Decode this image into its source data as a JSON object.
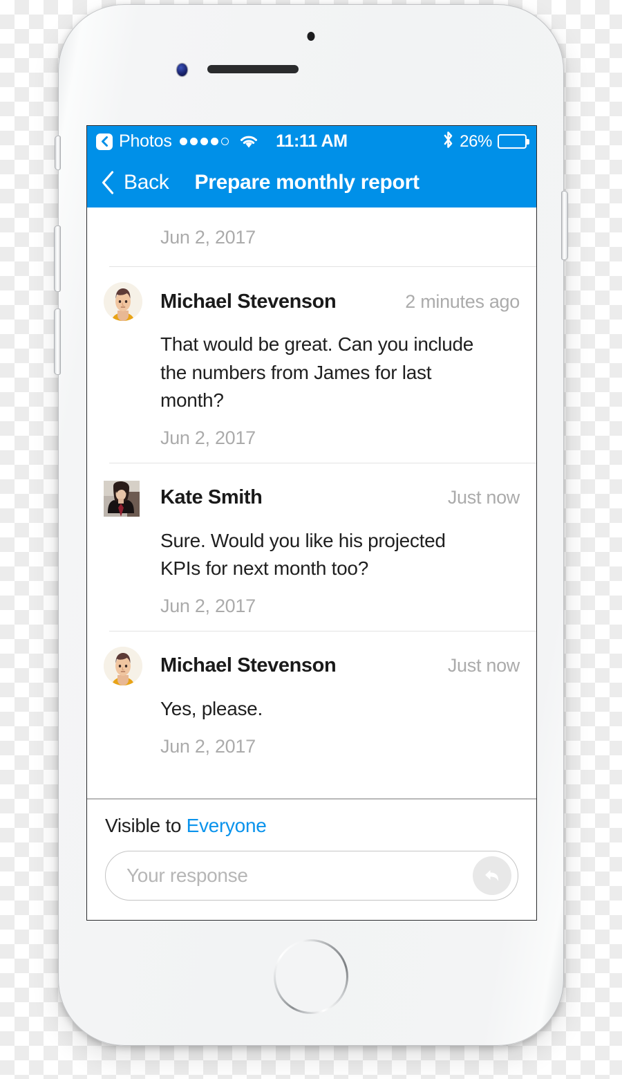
{
  "status_bar": {
    "back_app_label": "Photos",
    "back_icon": "chevron-left-icon",
    "signal_dots_total": 5,
    "signal_dots_filled": 4,
    "wifi_icon": "wifi-icon",
    "time": "11:11 AM",
    "bluetooth_icon": "bluetooth-icon",
    "battery_percent_label": "26%",
    "battery_level": 26,
    "background_color": "#0090E8"
  },
  "nav_bar": {
    "back_icon": "chevron-left-icon",
    "back_label": "Back",
    "title": "Prepare monthly report",
    "background_color": "#0090E8"
  },
  "thread": {
    "top_date": "Jun 2, 2017",
    "messages": [
      {
        "author": "Michael Stevenson",
        "time": "2 minutes ago",
        "text": "That would be great. Can you include the numbers from James for last month?",
        "date": "Jun 2, 2017",
        "avatar_type": "illustration-circle"
      },
      {
        "author": "Kate Smith",
        "time": "Just now",
        "text": "Sure. Would you like his projected KPIs for next month too?",
        "date": "Jun 2, 2017",
        "avatar_type": "photo-square"
      },
      {
        "author": "Michael Stevenson",
        "time": "Just now",
        "text": "Yes, please.",
        "date": "Jun 2, 2017",
        "avatar_type": "illustration-circle"
      }
    ]
  },
  "composer": {
    "visible_prefix": "Visible to ",
    "visible_audience": "Everyone",
    "visible_audience_color": "#0a93ec",
    "response_placeholder": "Your response",
    "response_value": "",
    "send_icon": "reply-arrow-icon"
  }
}
